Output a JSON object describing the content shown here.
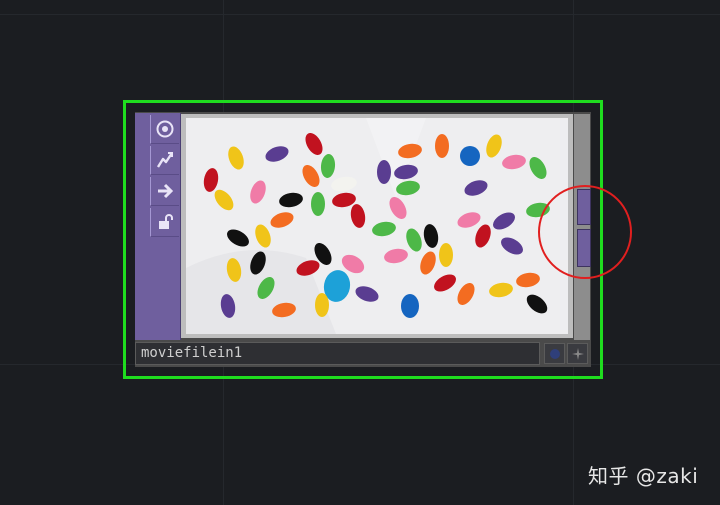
{
  "node": {
    "name": "moviefilein1",
    "selected": true,
    "selection_color": "#1fdd1f",
    "toolbar_color": "#6f5f9e",
    "toolbar_icons": [
      "viewer-icon",
      "bypass-icon",
      "export-icon",
      "lock-icon"
    ],
    "footer_icons": [
      "dot-icon",
      "cross-icon"
    ]
  },
  "overlay": {
    "highlight_color": "#e11f1f"
  },
  "watermark": {
    "text": "知乎 @zaki"
  }
}
